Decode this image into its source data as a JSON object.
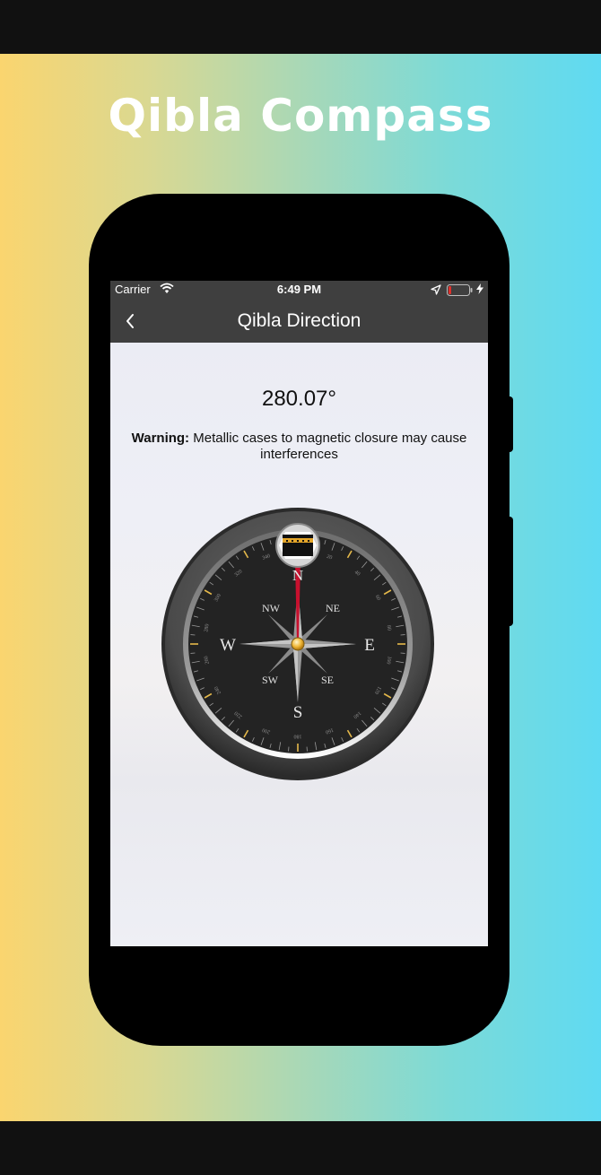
{
  "promo": {
    "title": "Qibla Compass"
  },
  "status_bar": {
    "carrier": "Carrier",
    "time": "6:49 PM"
  },
  "nav": {
    "title": "Qibla Direction"
  },
  "compass": {
    "heading": "280.07°",
    "cardinals": [
      "N",
      "E",
      "S",
      "W"
    ],
    "intercardinals": [
      "NE",
      "SE",
      "SW",
      "NW"
    ],
    "degree_labels": [
      "20",
      "40",
      "60",
      "80",
      "100",
      "120",
      "140",
      "160",
      "180",
      "200",
      "220",
      "240",
      "260",
      "280",
      "300",
      "320",
      "340"
    ]
  },
  "warning": {
    "label": "Warning:",
    "text": " Metallic cases to magnetic closure may cause interferences"
  },
  "colors": {
    "nav_bar": "#3f3f3f",
    "accent_gold": "#e4a62a",
    "battery_low": "#e0302b"
  }
}
